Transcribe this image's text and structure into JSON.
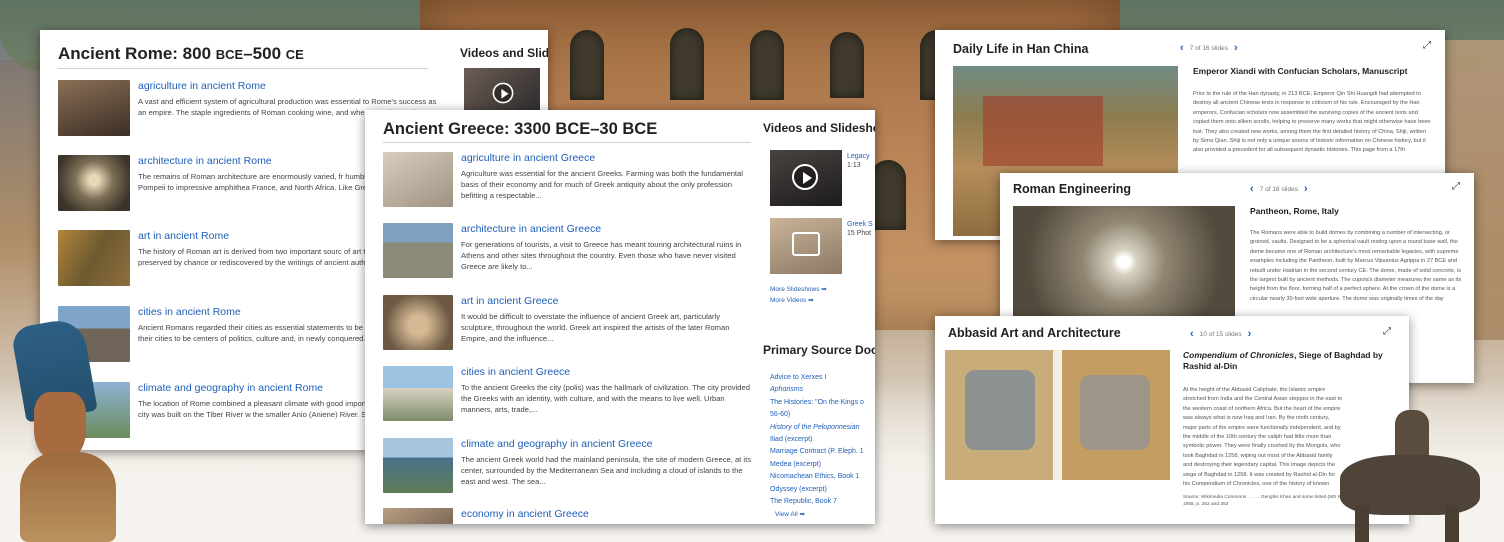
{
  "rome": {
    "title_prefix": "Ancient Rome: 800 ",
    "bce": "BCE",
    "title_mid": "–500 ",
    "ce": "CE",
    "side_heading": "Videos and Slide",
    "items": [
      {
        "title": "agriculture in ancient Rome",
        "desc": "A vast and efficient system of agricultural production was essential to Rome's success as an empire. The staple ingredients of Roman cooking wine, and wheat. Producing these..."
      },
      {
        "title": "architecture in ancient Rome",
        "desc": "The remains of Roman architecture are enormously varied, fr humble one-room home in Pompeii to impressive amphithea France, and North Africa. Like Greek buildings, the..."
      },
      {
        "title": "art in ancient Rome",
        "desc": "The history of Roman art is derived from two important sourc of art that have been preserved by chance or rediscovered by the writings of ancient authors...."
      },
      {
        "title": "cities in ancient Rome",
        "desc": "Ancient Romans regarded their cities as essential statements to be a Roman. They built their cities to be centers of politics, culture and, in newly conquered..."
      },
      {
        "title": "climate and geography in ancient Rome",
        "desc": "The location of Rome combined a pleasant climate with good important advantages. The city was built on the Tiber River w the smaller Anio (Aniene) River. Situated..."
      }
    ]
  },
  "greece": {
    "title": "Ancient Greece: 3300 BCE–30 BCE",
    "side_heading": "Videos and Slidesho",
    "items": [
      {
        "title": "agriculture in ancient Greece",
        "desc": "Agriculture was essential for the ancient Greeks. Farming was both the fundamental basis of their economy and for much of Greek antiquity about the only profession befitting a respectable..."
      },
      {
        "title": "architecture in ancient Greece",
        "desc": "For generations of tourists, a visit to Greece has meant touring architectural ruins in Athens and other sites throughout the country. Even those who have never visited Greece are likely to..."
      },
      {
        "title": "art in ancient Greece",
        "desc": "It would be difficult to overstate the influence of ancient Greek art, particularly sculpture, throughout the world. Greek art inspired the artists of the later Roman Empire, and the influence..."
      },
      {
        "title": "cities in ancient Greece",
        "desc": "To the ancient Greeks the city (polis) was the hallmark of civilization. The city provided the Greeks with an identity, with culture, and with the means to live well. Urban manners, arts, trade,..."
      },
      {
        "title": "climate and geography in ancient Greece",
        "desc": "The ancient Greek world had the mainland peninsula, the site of modern Greece, at its center, surrounded by the Mediterranean Sea and including a cloud of islands to the east and west. The sea..."
      },
      {
        "title": "economy in ancient Greece",
        "desc": ""
      }
    ],
    "videos": [
      {
        "label": "Legacy",
        "meta": "1:13"
      },
      {
        "label": "Greek S",
        "meta": "15 Phot"
      }
    ],
    "more_slideshows": "More Slideshows ➡",
    "more_videos": "More Videos ➡",
    "ps_heading": "Primary Source Doc",
    "primary_sources": [
      "Advice to Xerxes I",
      "Aphorisms",
      "The Histories: \"On the Kings o",
      "56-60)",
      "History of the Peloponnesian",
      "Iliad (excerpt)",
      "Marriage Contract (P. Eleph. 1",
      "Medea (excerpt)",
      "Nicomachean Ethics, Book 1",
      "Odyssey (excerpt)",
      "The Republic, Book 7"
    ],
    "view_all": "View All ➡"
  },
  "han": {
    "title": "Daily Life in Han China",
    "slide_count": "7 of 16 slides",
    "caption": "Emperor Xiandi with Confucian Scholars, Manuscript",
    "body": "Prior to the rule of the Han dynasty, in 213 BCE, Emperor Qin Shi Huangdi had attempted to destroy all ancient Chinese texts in response to criticism of his rule. Encouraged by the Han emperors, Confucian scholars now assembled the surviving copies of the ancient texts and copied them onto silken scrolls, helping to preserve many works that might otherwise have been lost. They also created new works, among them the first detailed history of China, Shiji, written by Sima Qian. Shiji is not only a unique source of historic information on Chinese history, but it also provided a precedent for all subsequent dynastic histories. This page from a 17th"
  },
  "eng": {
    "title": "Roman Engineering",
    "slide_count": "7 of 18 slides",
    "caption": "Pantheon, Rome, Italy",
    "body": "The Romans were able to build domes by combining a number of intersecting, or groined, vaults. Designed to be a spherical vault resting upon a round base wall, the dome became one of Roman architecture's most remarkable legacies, with supreme examples including the Pantheon, built by Marcus Vipsanius Agrippa in 27 BCE and rebuilt under Hadrian in the second century CE. The dome, made of solid concrete, is the largest built by ancient methods. The cupola's diameter measures the same as its height from the floor, forming half of a perfect sphere. At the crown of the dome is a circular nearly 30-foot wide aperture. The dome was originally times of the day"
  },
  "abb": {
    "title": "Abbasid Art and Architecture",
    "slide_count": "10 of 15 slides",
    "caption_italic": "Compendium of Chronicles",
    "caption_rest": ", Siege of Baghdad by Rashid al-Din",
    "body": "At the height of the Abbasid Caliphate, the Islamic empire stretched from India and the Central Asian steppes in the east to the western coast of northern Africa. But the heart of the empire was always what is now Iraq and Iran. By the ninth century, major parts of the empire were functionally independent, and by the middle of the 10th century the caliph had little more than symbolic power. They were finally crushed by the Mongols, who took Baghdad in 1258, wiping out most of the Abbasid family and destroying their legendary capital. This image depicts the siege of Baghdad in 1258. It was created by Rashid al-Din for his Compendium of Chronicles, one of the history of known civilizations.",
    "source": "Source: Wikimedia Commons . . . . . Genghis Khan and some listed (MS Wil bochen 1955, p. 252 and 253"
  },
  "colors": {
    "link": "#1f5fb8",
    "title": "#222222"
  }
}
